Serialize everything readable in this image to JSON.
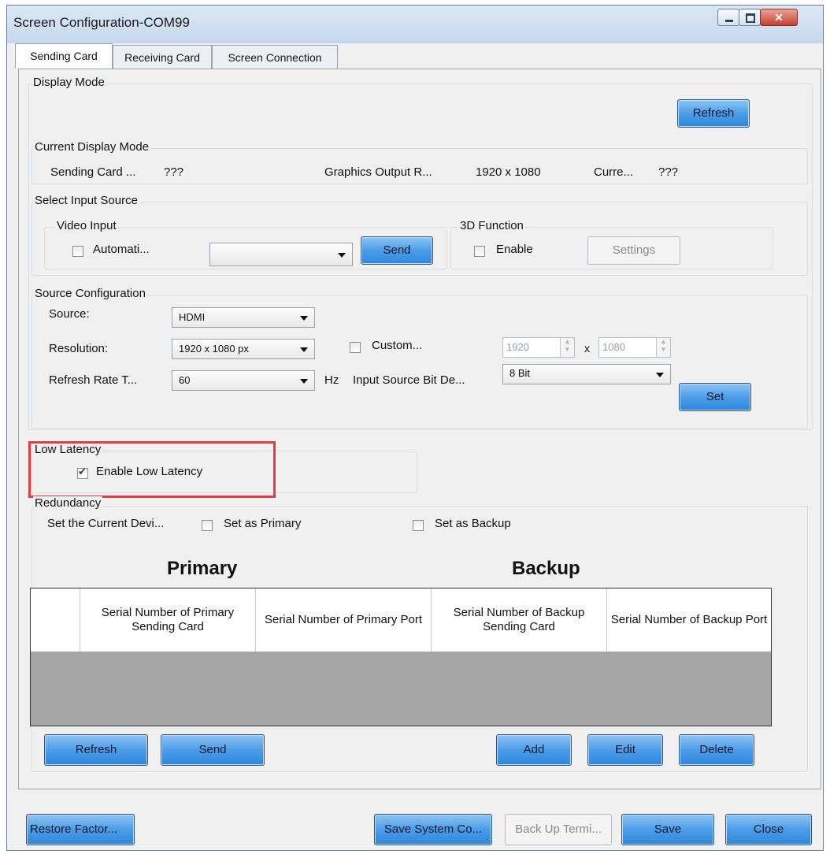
{
  "window": {
    "title": "Screen Configuration-COM99"
  },
  "tabs": [
    "Sending Card",
    "Receiving Card",
    "Screen Connection"
  ],
  "display_mode": {
    "group_label": "Display Mode",
    "refresh_label": "Refresh"
  },
  "current_display_mode": {
    "group_label": "Current Display Mode",
    "sending_card_label": "Sending Card ...",
    "sending_card_value": "???",
    "graphics_output_label": "Graphics Output R...",
    "graphics_output_value": "1920 x 1080",
    "current_label": "Curre...",
    "current_value": "???"
  },
  "input_source": {
    "group_label": "Select Input Source",
    "video_input_label": "Video Input",
    "automatic_label": "Automati...",
    "send_label": "Send",
    "function_3d_label": "3D Function",
    "enable_label": "Enable",
    "settings_label": "Settings"
  },
  "source_config": {
    "group_label": "Source Configuration",
    "source_label": "Source:",
    "source_value": "HDMI",
    "resolution_label": "Resolution:",
    "resolution_value": "1920 x 1080 px",
    "custom_label": "Custom...",
    "custom_width": "1920",
    "x_label": "x",
    "custom_height": "1080",
    "refresh_rate_label": "Refresh Rate T...",
    "refresh_rate_value": "60",
    "hz_label": "Hz",
    "bit_depth_label": "Input Source Bit De...",
    "bit_depth_value": "8 Bit",
    "set_label": "Set"
  },
  "low_latency": {
    "group_label": "Low Latency",
    "enable_label": "Enable Low Latency",
    "checked": true
  },
  "redundancy": {
    "group_label": "Redundancy",
    "set_device_label": "Set the Current Devi...",
    "set_primary_label": "Set as Primary",
    "set_backup_label": "Set as Backup",
    "primary_heading": "Primary",
    "backup_heading": "Backup",
    "columns": [
      "Serial Number of Primary Sending Card",
      "Serial Number of Primary Port",
      "Serial Number of Backup Sending Card",
      "Serial Number of Backup Port"
    ],
    "refresh_label": "Refresh",
    "send_label": "Send",
    "add_label": "Add",
    "edit_label": "Edit",
    "delete_label": "Delete"
  },
  "footer": {
    "restore_label": "Restore Factor...",
    "save_system_label": "Save System Co...",
    "backup_label": "Back Up Termi...",
    "save_label": "Save",
    "close_label": "Close"
  },
  "colors": {
    "button_blue": "#4b9de8",
    "highlight_red": "#e53c3c",
    "table_body_gray": "#a6a6a6"
  }
}
